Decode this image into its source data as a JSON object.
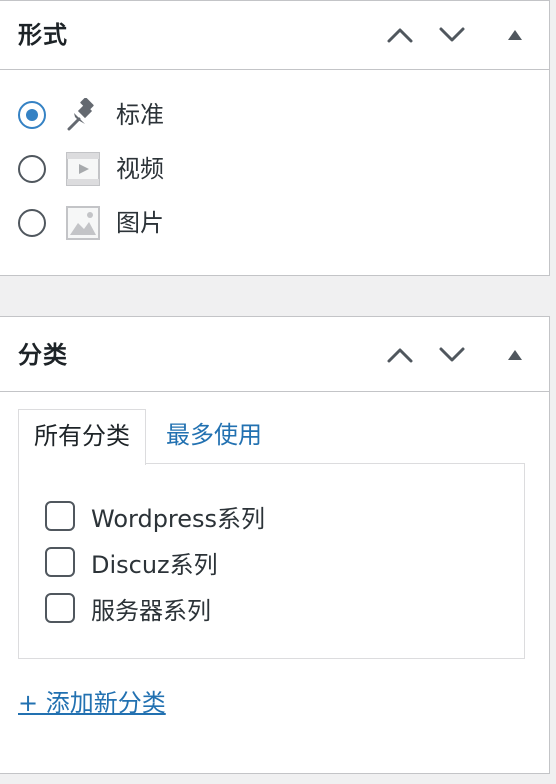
{
  "format_panel": {
    "title": "形式",
    "options": [
      {
        "label": "标准",
        "icon": "pushpin-icon",
        "checked": true
      },
      {
        "label": "视频",
        "icon": "video-icon",
        "checked": false
      },
      {
        "label": "图片",
        "icon": "image-icon",
        "checked": false
      }
    ]
  },
  "category_panel": {
    "title": "分类",
    "tabs": [
      {
        "label": "所有分类",
        "active": true
      },
      {
        "label": "最多使用",
        "active": false
      }
    ],
    "categories": [
      {
        "label": "Wordpress系列",
        "checked": false
      },
      {
        "label": "Discuz系列",
        "checked": false
      },
      {
        "label": "服务器系列",
        "checked": false
      }
    ],
    "add_link": "+ 添加新分类"
  },
  "colors": {
    "accent": "#3582c4",
    "link": "#2271b1",
    "border": "#c3c4c7",
    "background": "#f0f0f1"
  }
}
